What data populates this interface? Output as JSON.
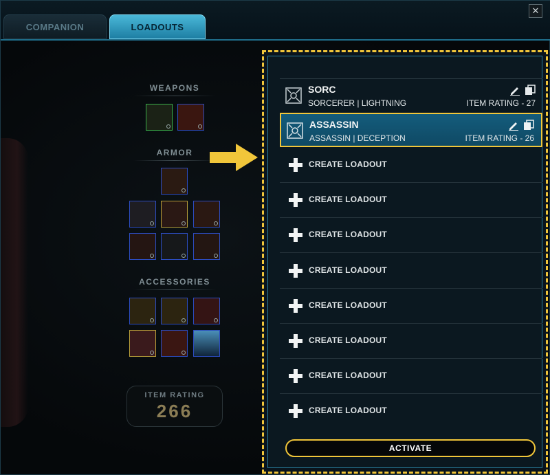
{
  "tabs": [
    {
      "label": "COMPANION",
      "active": false
    },
    {
      "label": "LOADOUTS",
      "active": true
    }
  ],
  "close_label": "✕",
  "equipment": {
    "weapons_title": "WEAPONS",
    "armor_title": "ARMOR",
    "accessories_title": "ACCESSORIES",
    "item_rating_label": "ITEM RATING",
    "item_rating_value": "266"
  },
  "loadouts": [
    {
      "name": "SORC",
      "sub": "SORCERER | LIGHTNING",
      "rating": "ITEM RATING - 27",
      "selected": false
    },
    {
      "name": "ASSASSIN",
      "sub": "ASSASSIN | DECEPTION",
      "rating": "ITEM RATING - 26",
      "selected": true
    }
  ],
  "create_label": "CREATE LOADOUT",
  "activate_label": "ACTIVATE",
  "colors": {
    "accent_yellow": "#f1c63a",
    "selected_blue": "#145c7c",
    "tab_active": "#4ab8d8"
  },
  "icons": [
    "close-icon",
    "loadout-emblem-icon",
    "edit-pencil-icon",
    "copy-icon",
    "plus-icon",
    "pointer-arrow-icon",
    "gear-icon"
  ]
}
